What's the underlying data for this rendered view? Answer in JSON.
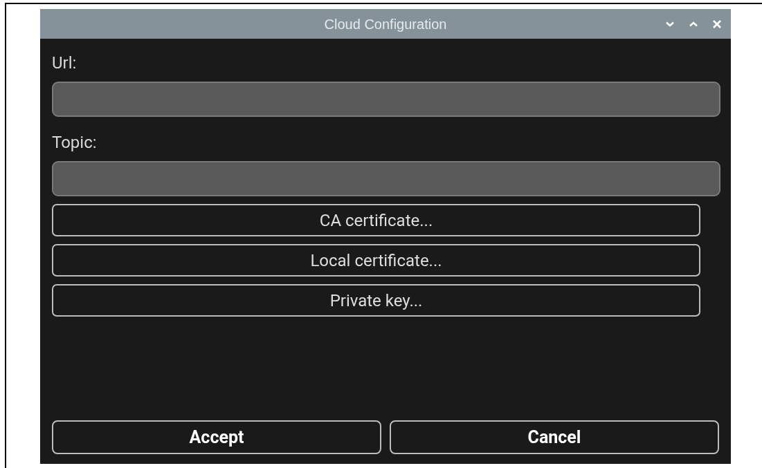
{
  "window": {
    "title": "Cloud Configuration"
  },
  "fields": [
    {
      "label": "Url:"
    },
    {
      "label": "Topic:"
    }
  ],
  "file_buttons": [
    "CA certificate...",
    "Local certificate...",
    "Private key..."
  ],
  "buttons": [
    "Accept",
    "Cancel"
  ]
}
